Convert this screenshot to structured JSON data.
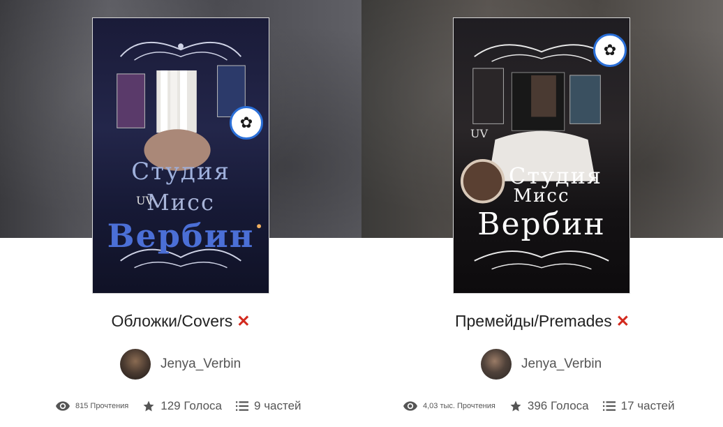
{
  "cards": [
    {
      "cover": {
        "line1": "Студия",
        "line2": "Мисс",
        "line3": "Вербин",
        "uv": "UV"
      },
      "title": "Обложки/Covers",
      "status_icon": "cross-mark-icon",
      "author": "Jenya_Verbin",
      "stats": {
        "reads": "815 Прочтения",
        "votes": "129 Голоса",
        "parts": "9 частей"
      }
    },
    {
      "cover": {
        "line1": "Студия",
        "line2": "Мисс",
        "line3": "Вербин",
        "uv": "UV"
      },
      "title": "Премейды/Premades",
      "status_icon": "cross-mark-icon",
      "author": "Jenya_Verbin",
      "stats": {
        "reads": "4,03 тыс. Прочтения",
        "votes": "396 Голоса",
        "parts": "17 частей"
      }
    }
  ],
  "colors": {
    "cross_mark": "#d32a1e",
    "stat_text": "#555555",
    "title_text": "#222222"
  }
}
